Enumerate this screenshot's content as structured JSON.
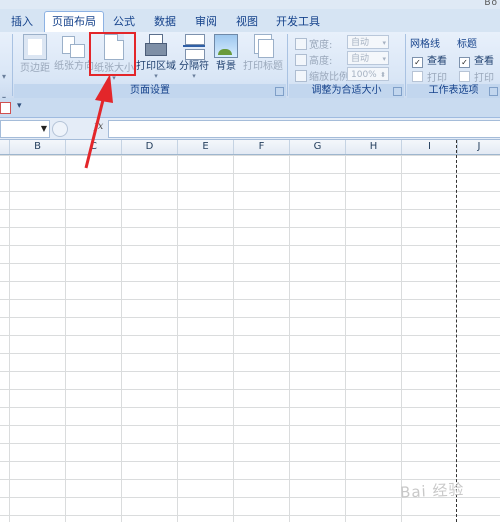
{
  "window": {
    "title_fragment": "Bo"
  },
  "tabs": [
    {
      "label": "插入"
    },
    {
      "label": "页面布局",
      "active": true
    },
    {
      "label": "公式"
    },
    {
      "label": "数据"
    },
    {
      "label": "审阅"
    },
    {
      "label": "视图"
    },
    {
      "label": "开发工具"
    }
  ],
  "ribbon": {
    "page_setup": {
      "label": "页面设置",
      "buttons": {
        "margins": "页边距",
        "orientation": "纸张方向",
        "size": "纸张大小",
        "print_area": "打印区域",
        "breaks": "分隔符",
        "background": "背景",
        "print_titles": "打印标题"
      }
    },
    "scale_to_fit": {
      "label": "调整为合适大小",
      "width_label": "宽度:",
      "width_value": "自动",
      "height_label": "高度:",
      "height_value": "自动",
      "scale_label": "缩放比例:",
      "scale_value": "100%"
    },
    "sheet_options": {
      "label": "工作表选项",
      "gridlines": {
        "head": "网格线",
        "view": "查看",
        "print": "打印"
      },
      "headings": {
        "head": "标题",
        "view": "查看",
        "print": "打印"
      }
    }
  },
  "formula_bar": {
    "fx": "fx",
    "name_box_value": "",
    "formula_value": ""
  },
  "columns": [
    "B",
    "C",
    "D",
    "E",
    "F",
    "G",
    "H",
    "I",
    "J"
  ],
  "watermark": "Bai 经验",
  "colors": {
    "highlight": "#e3262a",
    "tab_text": "#15428b"
  }
}
